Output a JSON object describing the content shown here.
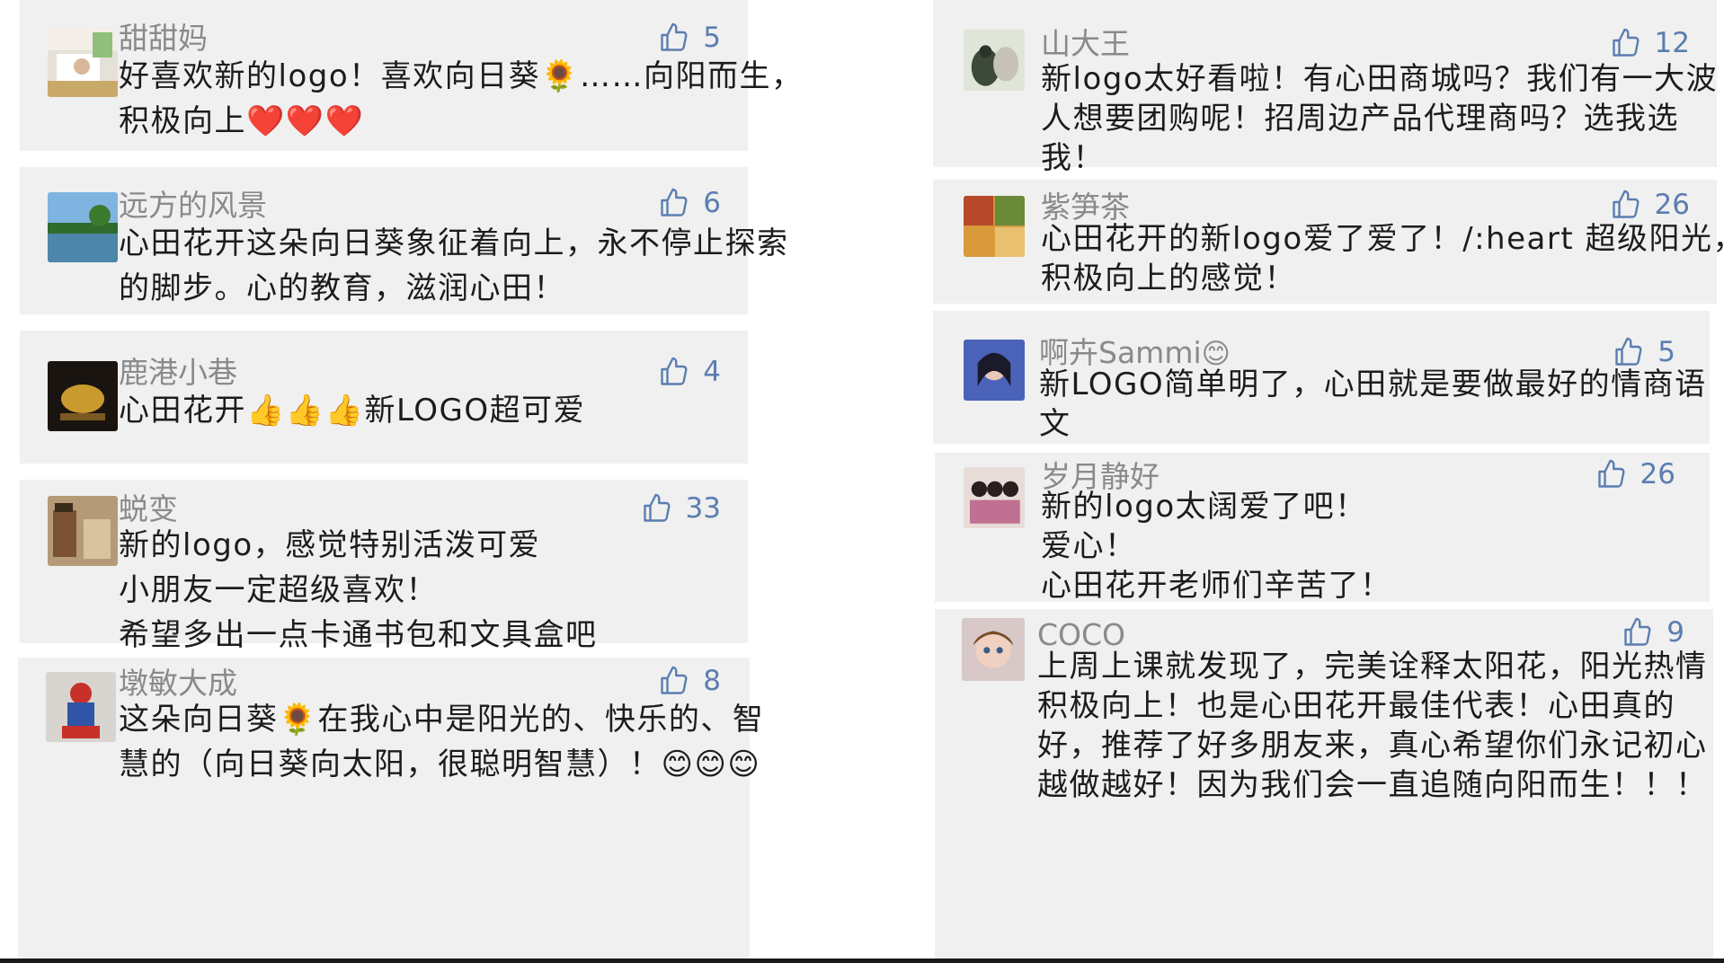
{
  "comments": [
    {
      "user": "甜甜妈",
      "likes": "5",
      "lines": [
        "好喜欢新的logo！喜欢向日葵🌻……向阳而生，",
        "积极向上❤️❤️❤️"
      ]
    },
    {
      "user": "远方的风景",
      "likes": "6",
      "lines": [
        "心田花开这朵向日葵象征着向上，永不停止探索",
        "的脚步。心的教育，滋润心田！"
      ]
    },
    {
      "user": "鹿港小巷",
      "likes": "4",
      "lines": [
        "心田花开👍👍👍新LOGO超可爱"
      ]
    },
    {
      "user": "蜕变",
      "likes": "33",
      "lines": [
        "新的logo，感觉特别活泼可爱",
        "小朋友一定超级喜欢！",
        "希望多出一点卡通书包和文具盒吧"
      ]
    },
    {
      "user": "墩敏大成",
      "likes": "8",
      "lines": [
        "这朵向日葵🌻在我心中是阳光的、快乐的、智",
        "慧的（向日葵向太阳，很聪明智慧）！😊😊😊"
      ]
    },
    {
      "user": "山大王",
      "likes": "12",
      "lines": [
        "新logo太好看啦！有心田商城吗？我们有一大波",
        "人想要团购呢！招周边产品代理商吗？选我选",
        "我！"
      ]
    },
    {
      "user": "紫笋茶",
      "likes": "26",
      "lines": [
        "心田花开的新logo爱了爱了！/:heart 超级阳光，",
        "积极向上的感觉！"
      ]
    },
    {
      "user": "啊卉Sammi",
      "user_emoji": "😊",
      "likes": "5",
      "lines": [
        "新LOGO简单明了，心田就是要做最好的情商语",
        "文"
      ]
    },
    {
      "user": "岁月静好",
      "likes": "26",
      "lines": [
        "新的logo太阔爱了吧！",
        "爱心！",
        "心田花开老师们辛苦了！"
      ]
    },
    {
      "user": "COCO",
      "likes": "9",
      "lines": [
        "上周上课就发现了，完美诠释太阳花，阳光热情",
        "积极向上！也是心田花开最佳代表！心田真的",
        "好，推荐了好多朋友来，真心希望你们永记初心",
        "越做越好！因为我们会一直追随向阳而生！！！"
      ]
    }
  ],
  "colors": {
    "card_bg": "#f0f0f0",
    "name": "#8a8a8a",
    "text": "#1c1c1c",
    "like": "#5a7eb0"
  },
  "icons": {
    "like": "thumbs-up-icon",
    "avatar": "user-avatar"
  }
}
